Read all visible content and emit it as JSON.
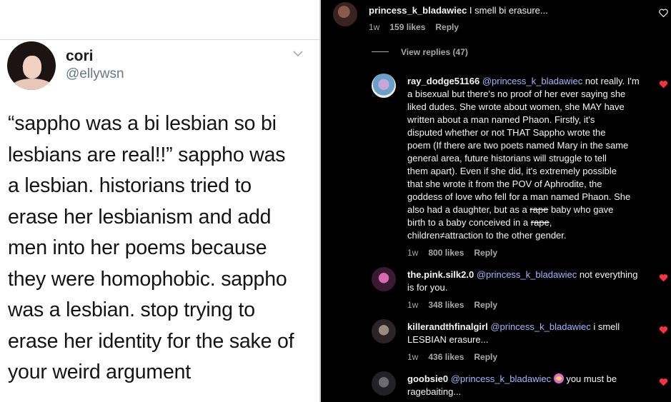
{
  "tweet": {
    "name": "cori",
    "handle": "@ellywsn",
    "lines": [
      "“sappho was a bi lesbian so bi",
      "lesbians are real!!” sappho was",
      "a lesbian. historians tried to",
      "erase her lesbianism and add",
      "men into her poems because",
      "they were homophobic. sappho",
      "was a lesbian. stop trying to",
      "erase her identity for the sake of",
      "your weird argument"
    ]
  },
  "comments": {
    "top": {
      "username": "princess_k_bladawiec",
      "text": " I smell bi erasure...",
      "time": "1w",
      "likes": "159 likes",
      "reply": "Reply"
    },
    "view_replies": "View replies (47)",
    "replies": [
      {
        "username": "ray_dodge51166",
        "mention": "@princess_k_bladawiec",
        "lines": [
          " not really. I'm",
          "a bisexual but there's no proof of her ever saying she",
          "liked dudes. She wrote about women, she MAY have",
          "written about a man named Phaon. Firstly, it's",
          "disputed whether or not THAT Sappho wrote the",
          "poem (If there are two poets named Mary in the same",
          "general area, future historians will struggle to tell",
          "them apart). Even if she did, it's extremely possible",
          "that she wrote it from the POV of Aphrodite, the",
          "goddess of love who fell for a man named Phaon. She",
          "also had a daughter, but as a ",
          "birth to a baby conceived in a ",
          "children≠attraction to the other gender."
        ],
        "censor1": "rape",
        "after1": " baby who gave",
        "censor2": "rape",
        "after2": ",",
        "time": "1w",
        "likes": "800 likes",
        "reply": "Reply"
      },
      {
        "username": "the.pink.silk2.0",
        "mention": "@princess_k_bladawiec",
        "line1": " not everything",
        "line2": "is for you.",
        "time": "1w",
        "likes": "348 likes",
        "reply": "Reply"
      },
      {
        "username": "killerandthfinalgirl",
        "mention": "@princess_k_bladawiec",
        "line1": " i smell",
        "line2": "LESBIAN erasure...",
        "time": "1w",
        "likes": "436 likes",
        "reply": "Reply"
      },
      {
        "username": "goobsie0",
        "mention": "@princess_k_bladawiec",
        "line1": " you must be",
        "line2": "ragebaiting..."
      }
    ]
  },
  "colors": {
    "heart": "#ff3040",
    "mention": "#a7b4ff",
    "meta": "#a8a8a8"
  }
}
